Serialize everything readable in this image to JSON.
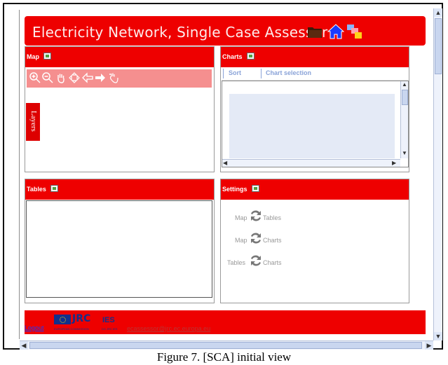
{
  "header": {
    "title": "Electricity Network, Single Case Assessor",
    "icons": [
      "folder-icon",
      "home-icon",
      "windows-icon"
    ]
  },
  "panels": {
    "map": {
      "title": "Map",
      "layers_label": "Layers"
    },
    "charts": {
      "title": "Charts",
      "tabs": [
        "Sort",
        "Chart selection"
      ]
    },
    "tables": {
      "title": "Tables"
    },
    "settings": {
      "title": "Settings",
      "links": [
        {
          "left": "Map",
          "right": "Tables"
        },
        {
          "left": "Map",
          "right": "Charts"
        },
        {
          "left": "Tables",
          "right": "Charts"
        }
      ]
    }
  },
  "footer": {
    "logout": "Logout",
    "jrc": "JRC",
    "eu_text": "EUROPEAN COMMISSION",
    "ies_text": "IES",
    "ies_sub": "DG JRC IES",
    "email": "ecassessor@jrc.ec.europa.eu"
  },
  "caption": "Figure 7. [SCA] initial view",
  "colors": {
    "accent": "#ee0000",
    "toolbar": "#f58f8f",
    "tab_text": "#8aa3d8"
  }
}
